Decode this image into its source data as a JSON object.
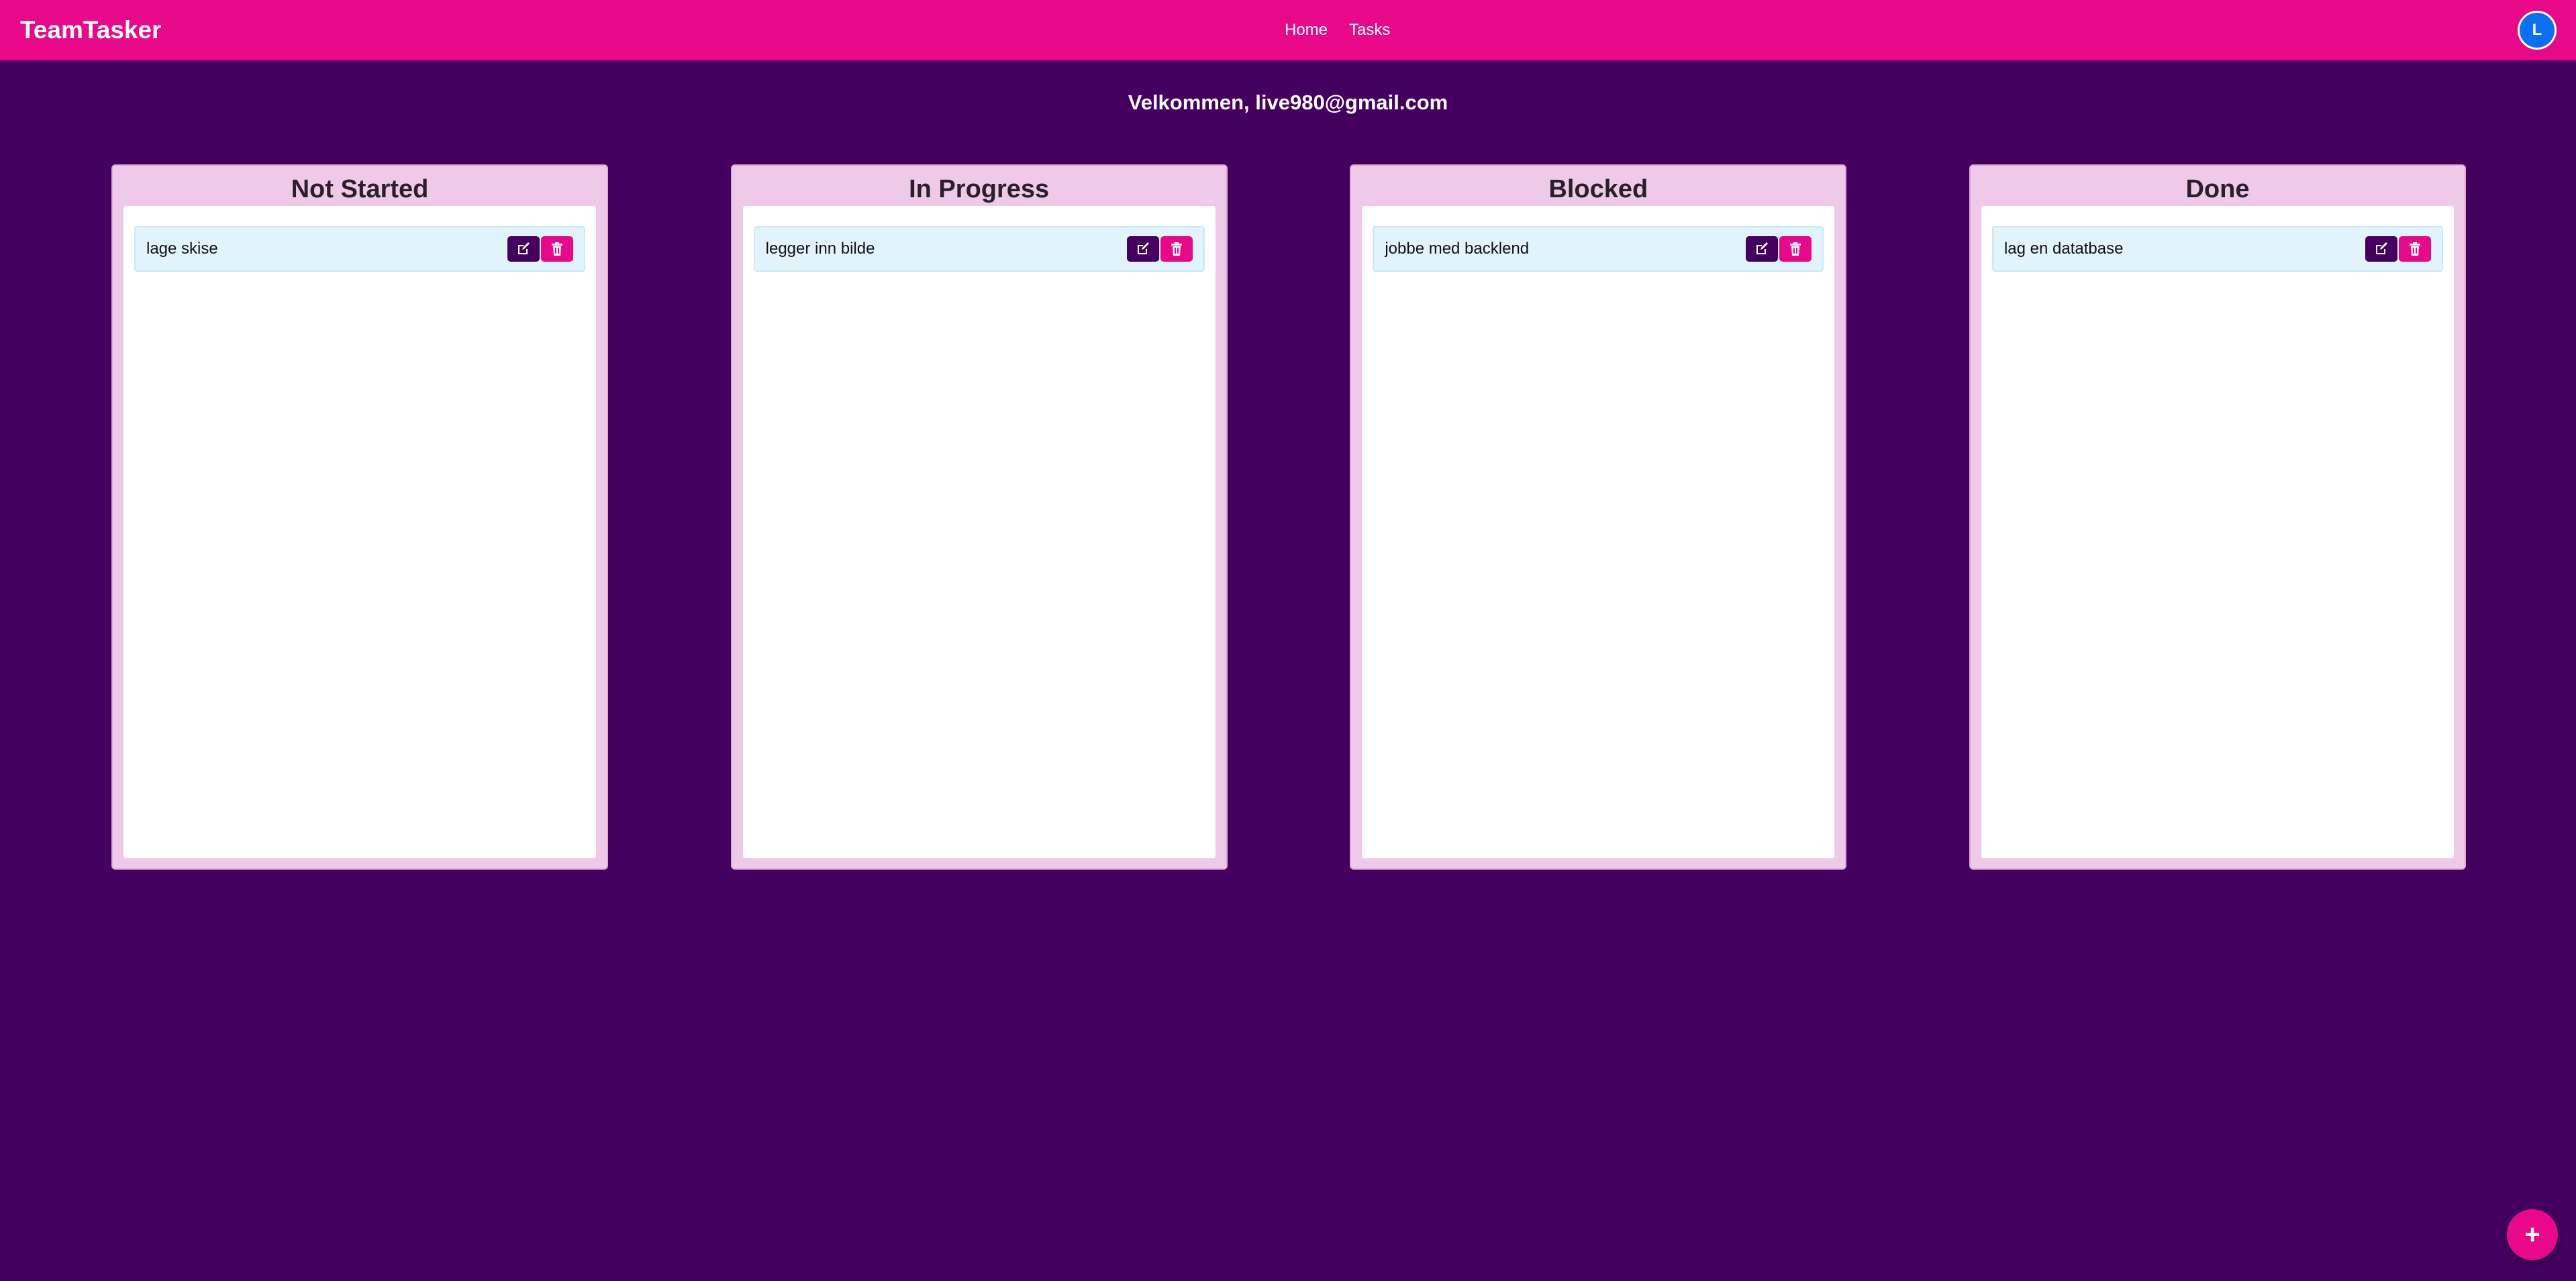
{
  "app": {
    "brand": "TeamTasker",
    "nav": [
      {
        "label": "Home"
      },
      {
        "label": "Tasks"
      }
    ],
    "avatar_initial": "L"
  },
  "welcome": "Velkommen, live980@gmail.com",
  "columns": [
    {
      "title": "Not Started",
      "tasks": [
        {
          "title": "lage skise"
        }
      ]
    },
    {
      "title": "In Progress",
      "tasks": [
        {
          "title": "legger inn bilde"
        }
      ]
    },
    {
      "title": "Blocked",
      "tasks": [
        {
          "title": "jobbe med backlend"
        }
      ]
    },
    {
      "title": "Done",
      "tasks": [
        {
          "title": "lag en datatbase"
        }
      ]
    }
  ],
  "icons": {
    "edit": "edit-icon",
    "delete": "trash-icon",
    "add": "plus-icon"
  },
  "fab_label": "+",
  "colors": {
    "background": "#43005e",
    "navbar": "#e8098a",
    "column": "#eecae8",
    "task_card": "#e1f4fb",
    "edit_button": "#43005e",
    "delete_button": "#e8098a",
    "avatar": "#0a6ff2"
  }
}
